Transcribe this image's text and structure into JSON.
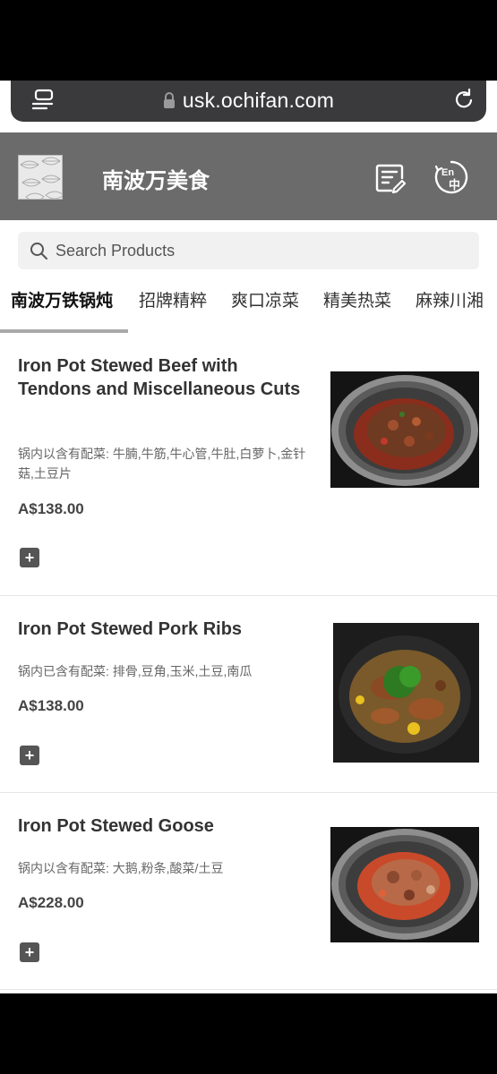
{
  "browser": {
    "url": "usk.ochifan.com"
  },
  "header": {
    "store_name": "南波万美食"
  },
  "search": {
    "placeholder": "Search Products"
  },
  "tabs": [
    {
      "label": "南波万铁锅炖",
      "active": true
    },
    {
      "label": "招牌精粹"
    },
    {
      "label": "爽口凉菜"
    },
    {
      "label": "精美热菜"
    },
    {
      "label": "麻辣川湘"
    }
  ],
  "items": [
    {
      "title": "Iron Pot Stewed Beef with Tendons and Miscellaneous Cuts",
      "description": "锅内以含有配菜: 牛腩,牛筋,牛心管,牛肚,白萝卜,金针菇,土豆片",
      "price": "A$138.00"
    },
    {
      "title": "Iron Pot Stewed Pork Ribs",
      "description": "锅内已含有配菜: 排骨,豆角,玉米,土豆,南瓜",
      "price": "A$138.00"
    },
    {
      "title": "Iron Pot Stewed Goose",
      "description": "锅内以含有配菜: 大鹅,粉条,酸菜/土豆",
      "price": "A$228.00"
    }
  ],
  "colors": {
    "header_bg": "#6b6b6b",
    "url_bar_bg": "#3a3a3c",
    "tab_underline": "#a9a9a9",
    "add_button": "#555555"
  }
}
